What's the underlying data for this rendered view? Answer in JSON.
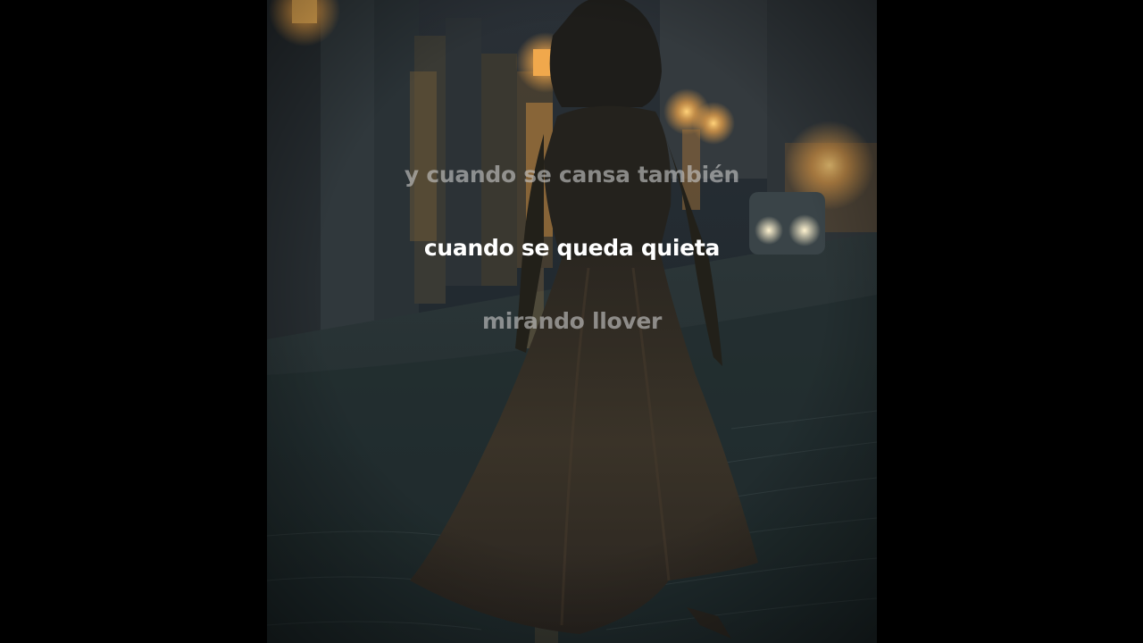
{
  "lyrics": {
    "previous": "y cuando se cansa también",
    "current": "cuando se queda quieta",
    "next": "mirando llover"
  },
  "colors": {
    "letterbox": "#000000",
    "active_lyric": "#ffffff",
    "dim_lyric": "#c8c8c8",
    "lamp_glow": "#f4b25a"
  }
}
